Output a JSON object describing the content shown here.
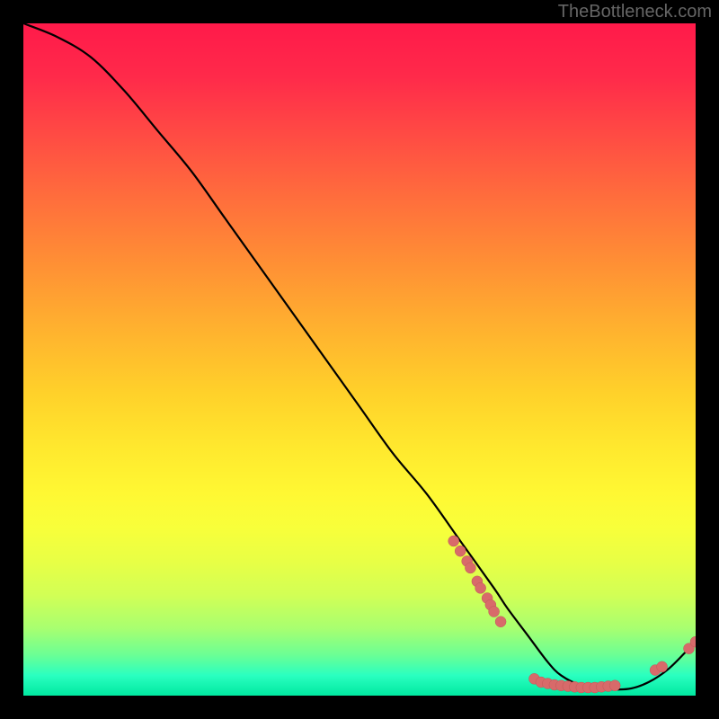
{
  "watermark": "TheBottleneck.com",
  "chart_data": {
    "type": "line",
    "title": "",
    "xlabel": "",
    "ylabel": "",
    "xlim": [
      0,
      100
    ],
    "ylim": [
      0,
      100
    ],
    "curve": {
      "name": "bottleneck-curve",
      "x": [
        0,
        5,
        10,
        15,
        20,
        25,
        30,
        35,
        40,
        45,
        50,
        55,
        60,
        65,
        70,
        72,
        75,
        78,
        80,
        83,
        86,
        90,
        93,
        96,
        99,
        100
      ],
      "y": [
        100,
        98,
        95,
        90,
        84,
        78,
        71,
        64,
        57,
        50,
        43,
        36,
        30,
        23,
        16,
        13,
        9,
        5,
        3,
        1.5,
        1,
        1,
        2,
        4,
        7,
        8
      ]
    },
    "scatter_cluster": {
      "name": "data-points",
      "points": [
        {
          "x": 64,
          "y": 23
        },
        {
          "x": 65,
          "y": 21.5
        },
        {
          "x": 66,
          "y": 20
        },
        {
          "x": 66.5,
          "y": 19
        },
        {
          "x": 67.5,
          "y": 17
        },
        {
          "x": 68,
          "y": 16
        },
        {
          "x": 69,
          "y": 14.5
        },
        {
          "x": 69.5,
          "y": 13.5
        },
        {
          "x": 70,
          "y": 12.5
        },
        {
          "x": 71,
          "y": 11
        },
        {
          "x": 76,
          "y": 2.5
        },
        {
          "x": 77,
          "y": 2
        },
        {
          "x": 78,
          "y": 1.8
        },
        {
          "x": 79,
          "y": 1.6
        },
        {
          "x": 80,
          "y": 1.5
        },
        {
          "x": 81,
          "y": 1.4
        },
        {
          "x": 82,
          "y": 1.3
        },
        {
          "x": 83,
          "y": 1.2
        },
        {
          "x": 84,
          "y": 1.2
        },
        {
          "x": 85,
          "y": 1.2
        },
        {
          "x": 86,
          "y": 1.3
        },
        {
          "x": 87,
          "y": 1.4
        },
        {
          "x": 88,
          "y": 1.5
        },
        {
          "x": 94,
          "y": 3.8
        },
        {
          "x": 95,
          "y": 4.3
        },
        {
          "x": 99,
          "y": 7
        },
        {
          "x": 100,
          "y": 8
        }
      ]
    }
  }
}
